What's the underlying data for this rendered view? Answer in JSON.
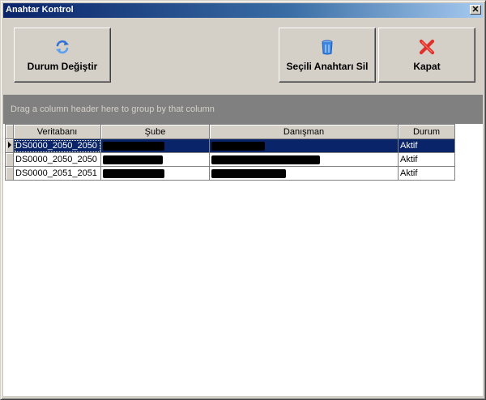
{
  "window": {
    "title": "Anahtar Kontrol",
    "close_glyph": "✕"
  },
  "toolbar": {
    "durum_label": "Durum Değiştir",
    "durum_icon": "refresh-icon",
    "sil_label": "Seçili Anahtarı Sil",
    "sil_icon": "trash-icon",
    "kapat_label": "Kapat",
    "kapat_icon": "close-x-icon"
  },
  "group_panel": {
    "text": "Drag a column header here to group by that column"
  },
  "grid": {
    "columns": [
      "Veritabanı",
      "Şube",
      "Danışman",
      "Durum"
    ],
    "rows": [
      {
        "veritabani": "DS0000_2050_2050",
        "sube": "[redacted]",
        "danisman": "[redacted]",
        "durum": "Aktif",
        "selected": true
      },
      {
        "veritabani": "DS0000_2050_2050",
        "sube": "[redacted]",
        "danisman": "[redacted]",
        "durum": "Aktif",
        "selected": false
      },
      {
        "veritabani": "DS0000_2051_2051",
        "sube": "[redacted]",
        "danisman": "[redacted]",
        "durum": "Aktif",
        "selected": false
      }
    ]
  },
  "colors": {
    "title_gradient_start": "#0a246a",
    "title_gradient_end": "#a6caf0",
    "selection": "#0a246a",
    "face": "#d4d0c8",
    "group_panel": "#808080"
  }
}
